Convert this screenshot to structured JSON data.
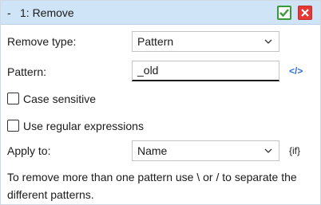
{
  "header": {
    "collapse_symbol": "-",
    "title": "1: Remove",
    "ok_icon": "check-icon",
    "close_icon": "close-icon",
    "ok_color": "#3a9a3a",
    "close_color": "#e53935"
  },
  "remove_type": {
    "label": "Remove type:",
    "value": "Pattern"
  },
  "pattern": {
    "label": "Pattern:",
    "value": "_old",
    "side_icon": "code-icon",
    "side_text": "</>"
  },
  "options": {
    "case_sensitive": {
      "label": "Case sensitive",
      "checked": false
    },
    "regex": {
      "label": "Use regular expressions",
      "checked": false
    }
  },
  "apply_to": {
    "label": "Apply to:",
    "value": "Name",
    "side_text": "{if}"
  },
  "help_text": "To remove more than one pattern use \\ or / to separate the different patterns."
}
